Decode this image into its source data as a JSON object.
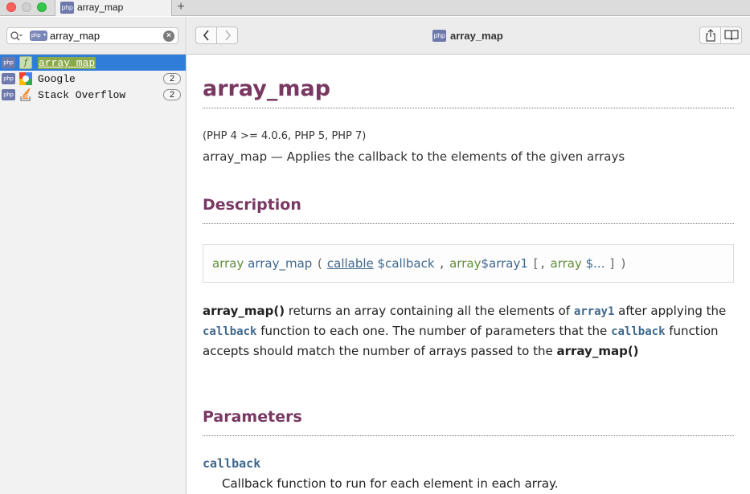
{
  "tab": {
    "title": "array_map",
    "new_tab": "+",
    "icon": "php-docset-icon"
  },
  "sidebar": {
    "search": {
      "value": "array_map",
      "docset": "php",
      "placeholder": ""
    },
    "results": [
      {
        "docset": "php",
        "kind": "function-icon",
        "label": "array_map",
        "count": "",
        "selected": true
      },
      {
        "docset": "php",
        "kind": "google-icon",
        "label": "Google",
        "count": "2",
        "selected": false
      },
      {
        "docset": "php",
        "kind": "stackoverflow-icon",
        "label": "Stack Overflow",
        "count": "2",
        "selected": false
      }
    ]
  },
  "toolbar": {
    "title": "array_map",
    "back": "‹",
    "forward": "›"
  },
  "page": {
    "heading": "array_map",
    "version": "(PHP 4 >= 4.0.6, PHP 5, PHP 7)",
    "refpurpose": "array_map — Applies the callback to the elements of the given arrays",
    "description_heading": "Description",
    "synopsis": {
      "return_type": "array",
      "func": "array_map",
      "open": "(",
      "p1_type": "callable",
      "p1_var": "$callback",
      "comma": ",",
      "p2_type": "array",
      "p2_var": "$array1",
      "optional_open": "[,",
      "p3_type": "array",
      "p3_var": "$...",
      "optional_close": "]",
      "close": ")"
    },
    "para": {
      "t1": "array_map()",
      "t2": " returns an array containing all the elements of ",
      "t3": "array1",
      "t4": " after applying the ",
      "t5": "callback",
      "t6": " function to each one. The number of parameters that the ",
      "t7": "callback",
      "t8": " function accepts should match the number of arrays passed to the ",
      "t9": "array_map()"
    },
    "parameters_heading": "Parameters",
    "param_term": "callback",
    "param_desc": "Callback function to run for each element in each array."
  },
  "colors": {
    "accent_heading": "#793862",
    "selection": "#2f7dd9",
    "code_blue": "#3f688d",
    "type_green": "#62903b"
  }
}
